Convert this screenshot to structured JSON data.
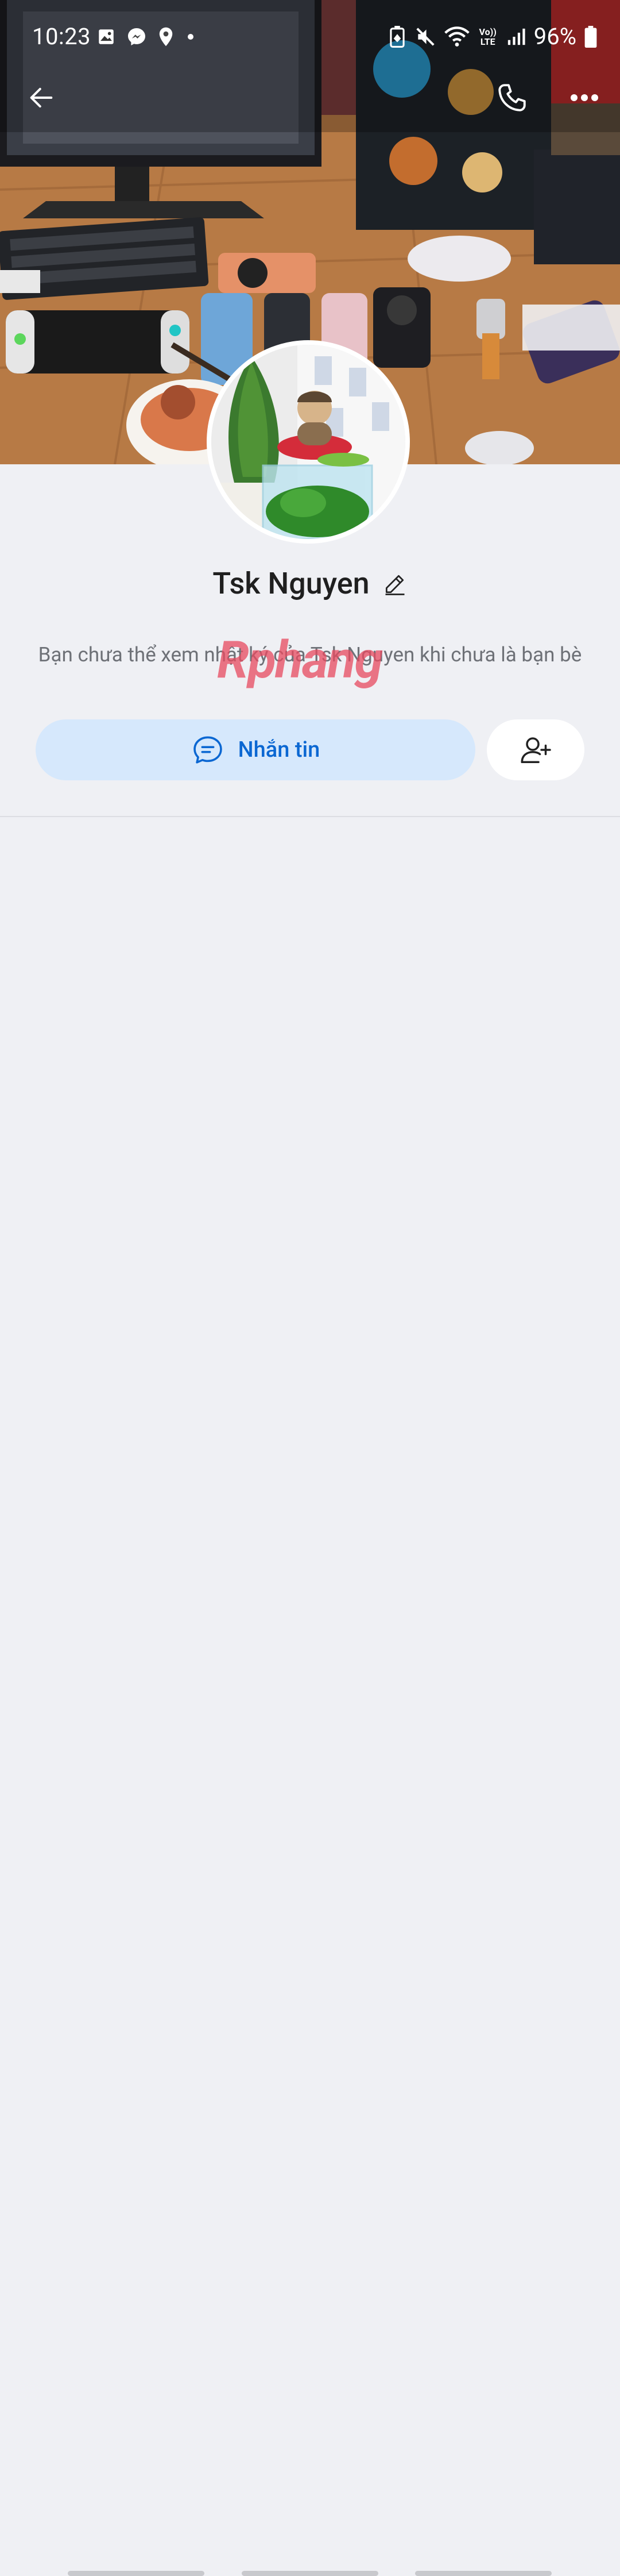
{
  "status_bar": {
    "time": "10:23",
    "battery": "96%",
    "left_icons": [
      "image-icon",
      "messenger-icon",
      "location-icon",
      "dot-icon"
    ],
    "right_icons": [
      "battery-saver-icon",
      "mute-icon",
      "wifi-icon",
      "volte-icon",
      "signal-icon",
      "battery-icon"
    ],
    "volte_label": "Vo)) LTE"
  },
  "header": {
    "back_icon": "back-arrow-icon",
    "call_icon": "phone-icon",
    "more_icon": "more-dots-icon"
  },
  "profile": {
    "name": "Tsk Nguyen",
    "edit_icon": "pencil-icon",
    "notice": "Bạn chưa thể xem nhật ký của Tsk Nguyen khi chưa là bạn bè",
    "watermark": "Rphang"
  },
  "actions": {
    "message_label": "Nhắn tin",
    "message_icon": "chat-bubble-icon",
    "add_friend_icon": "add-friend-icon"
  },
  "colors": {
    "accent": "#0b67d2",
    "message_button_bg": "#d6e8fc",
    "page_bg": "#eff0f4"
  }
}
